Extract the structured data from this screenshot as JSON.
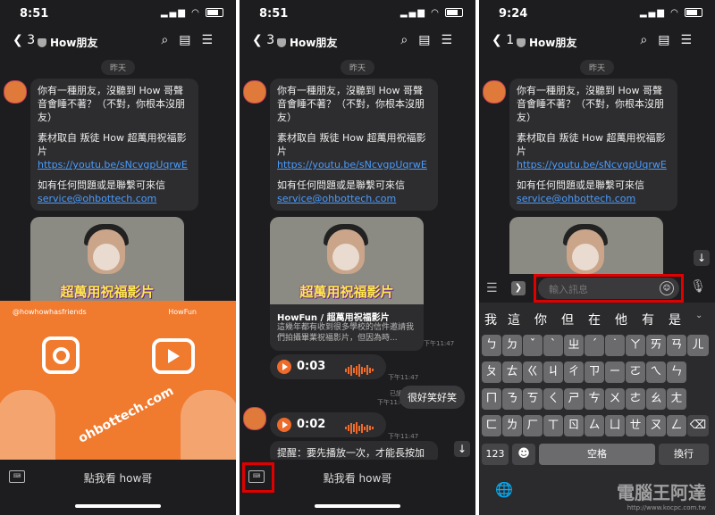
{
  "screens": [
    {
      "time": "8:51",
      "nav": {
        "back_count": "3",
        "title": "How朋友"
      },
      "date_label": "昨天",
      "message": {
        "intro": "你有一種朋友，沒聽到 How 哥聲音會睡不著？（不對，你根本沒朋友）",
        "source": "素材取自 叛徒 How 超萬用祝福影片",
        "link": "https://youtu.be/sNcvgpUqrwE",
        "contact": "如有任何問題或是聯繫可來信",
        "email": "service@ohbottech.com"
      },
      "thumb_caption": "超萬用祝福影片",
      "promo": {
        "instagram_handle": "@howhowhasfriends",
        "youtube_name": "HowFun",
        "site": "ohbottech.com"
      },
      "bottom_label": "點我看 how哥",
      "keyboard_icon_text": "⌨"
    },
    {
      "time": "8:51",
      "nav": {
        "back_count": "3",
        "title": "How朋友"
      },
      "date_label": "昨天",
      "message": {
        "intro": "你有一種朋友，沒聽到 How 哥聲音會睡不著？（不對，你根本沒朋友）",
        "source": "素材取自 叛徒 How 超萬用祝福影片",
        "link": "https://youtu.be/sNcvgpUqrwE",
        "contact": "如有任何問題或是聯繫可來信",
        "email": "service@ohbottech.com"
      },
      "thumb_caption": "超萬用祝福影片",
      "card": {
        "title": "HowFun / 超萬用祝福影片",
        "desc": "這幾年都有收到很多學校的信件邀請我們拍攝畢業祝福影片，但因為時..."
      },
      "time_1147": "下午11:47",
      "voice1": "0:03",
      "read_label": "已讀",
      "outgoing": "很好笑好笑",
      "voice2": "0:02",
      "reminder": "提醒：要先播放一次，才能長按加到最愛",
      "bottom_label": "點我看 how哥",
      "keyboard_icon_text": "⌨"
    },
    {
      "time": "9:24",
      "nav": {
        "back_count": "1",
        "title": "How朋友"
      },
      "date_label": "昨天",
      "message": {
        "intro": "你有一種朋友，沒聽到 How 哥聲音會睡不著？（不對，你根本沒朋友）",
        "source": "素材取自 叛徒 How 超萬用祝福影片",
        "link": "https://youtu.be/sNcvgpUqrwE",
        "contact": "如有任何問題或是聯繫可來信",
        "email": "service@ohbottech.com"
      },
      "input_placeholder": "輸入訊息",
      "suggestions": [
        "我",
        "這",
        "你",
        "但",
        "在",
        "他",
        "有",
        "是"
      ],
      "keys": {
        "row1": [
          "ㄅ",
          "ㄉ",
          "ˇ",
          "ˋ",
          "ㄓ",
          "ˊ",
          "˙",
          "ㄚ",
          "ㄞ",
          "ㄢ",
          "ㄦ"
        ],
        "row2": [
          "ㄆ",
          "ㄊ",
          "ㄍ",
          "ㄐ",
          "ㄔ",
          "ㄗ",
          "ㄧ",
          "ㄛ",
          "ㄟ",
          "ㄣ"
        ],
        "row3": [
          "ㄇ",
          "ㄋ",
          "ㄎ",
          "ㄑ",
          "ㄕ",
          "ㄘ",
          "ㄨ",
          "ㄜ",
          "ㄠ",
          "ㄤ"
        ],
        "row4": [
          "ㄈ",
          "ㄌ",
          "ㄏ",
          "ㄒ",
          "ㄖ",
          "ㄙ",
          "ㄩ",
          "ㄝ",
          "ㄡ",
          "ㄥ"
        ],
        "num": "123",
        "space": "空格",
        "enter": "換行",
        "delete": "⌫",
        "emoji": "☻",
        "globe": "🌐"
      }
    }
  ],
  "watermark": {
    "text": "電腦王阿達",
    "url": "http://www.kocpc.com.tw"
  },
  "colors": {
    "highlight": "#e00000",
    "link": "#4a9cff",
    "promo": "#f07a2e",
    "voice": "#f06a2a"
  }
}
